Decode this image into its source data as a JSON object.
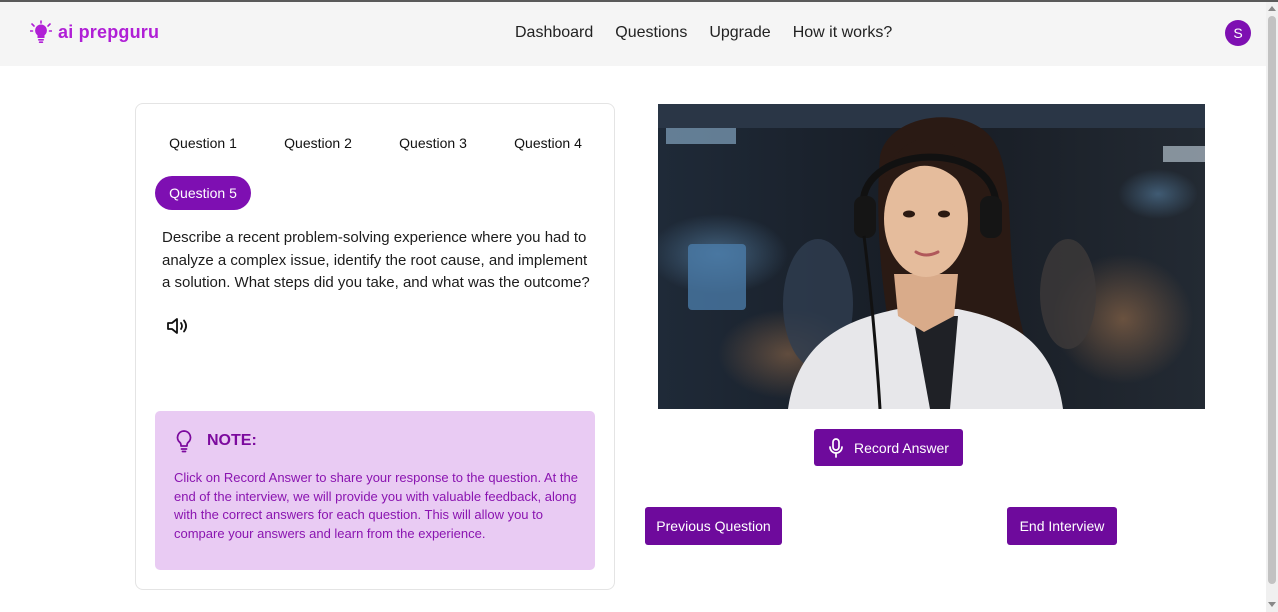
{
  "brand": {
    "name": "ai prepguru",
    "color": "#b01fd6"
  },
  "nav": {
    "items": [
      "Dashboard",
      "Questions",
      "Upgrade",
      "How it works?"
    ]
  },
  "user": {
    "avatar_initial": "S"
  },
  "questions": {
    "tabs": [
      "Question 1",
      "Question 2",
      "Question 3",
      "Question 4",
      "Question 5"
    ],
    "active_index": 4,
    "current_text": "Describe a recent problem-solving experience where you had to analyze a complex issue, identify the root cause, and implement a solution. What steps did you take, and what was the outcome?",
    "speaker_icon": "speaker-icon"
  },
  "note": {
    "title": "NOTE:",
    "icon": "lightbulb-icon",
    "body": "Click on Record Answer to share your response to the question. At the end of the interview, we will provide you with valuable feedback, along with the correct answers for each question. This will allow you to compare your answers and learn from the experience."
  },
  "actions": {
    "record_label": "Record Answer",
    "record_icon": "microphone-icon",
    "previous_label": "Previous Question",
    "end_label": "End Interview"
  },
  "colors": {
    "accent": "#7e0fb2",
    "note_bg": "#e9cbf3",
    "note_text": "#8a14b0"
  }
}
